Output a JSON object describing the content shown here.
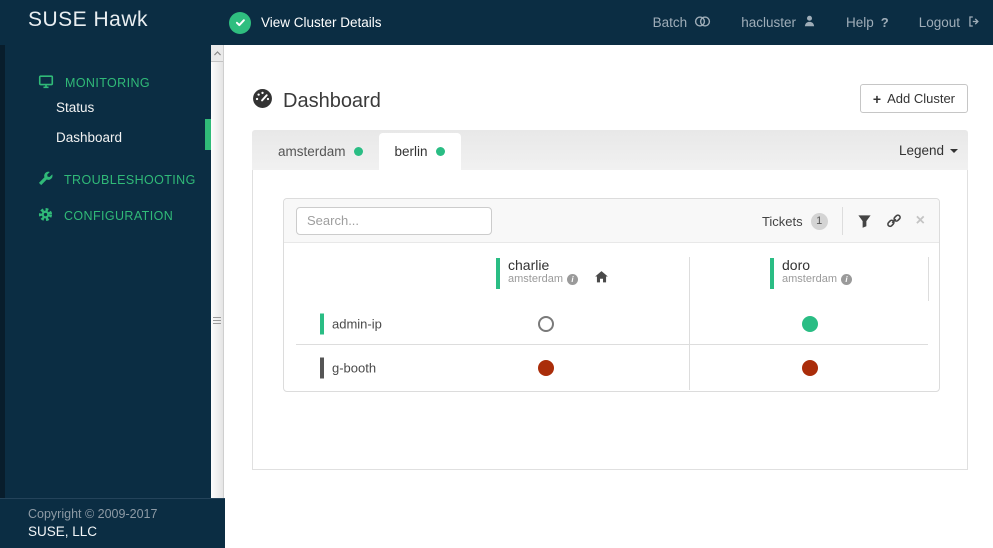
{
  "colors": {
    "navbar_navy": "#0b2d43",
    "accent_green": "#30ba78",
    "status_ok_green": "#2abd84",
    "status_error_red": "#aa2d0a"
  },
  "navbar": {
    "brand": "SUSE Hawk",
    "cluster_status": "View Cluster Details",
    "batch": "Batch",
    "user": "hacluster",
    "help": "Help",
    "logout": "Logout"
  },
  "icons": {
    "plus": "+",
    "help": "?",
    "close": "×",
    "info": "i"
  },
  "sidebar": {
    "monitoring": "MONITORING",
    "status": "Status",
    "dashboard": "Dashboard",
    "troubleshooting": "TROUBLESHOOTING",
    "configuration": "CONFIGURATION"
  },
  "footer": {
    "line1": "Copyright © 2009-2017",
    "line2": "SUSE, LLC"
  },
  "main": {
    "title": "Dashboard",
    "add_cluster": "Add Cluster",
    "tabs": [
      {
        "label": "amsterdam",
        "status": "ok"
      },
      {
        "label": "berlin",
        "status": "ok"
      }
    ],
    "legend": "Legend",
    "toolbar": {
      "search_placeholder": "Search...",
      "tickets_label": "Tickets",
      "tickets_count": "1"
    },
    "table": {
      "columns": [
        {
          "name": "charlie",
          "location": "amsterdam",
          "is_home": true
        },
        {
          "name": "doro",
          "location": "amsterdam",
          "is_home": false
        }
      ],
      "rows": [
        {
          "name": "admin-ip",
          "bar": "green",
          "statuses": [
            "empty",
            "ok"
          ]
        },
        {
          "name": "g-booth",
          "bar": "gray",
          "statuses": [
            "error",
            "error"
          ]
        }
      ]
    }
  }
}
